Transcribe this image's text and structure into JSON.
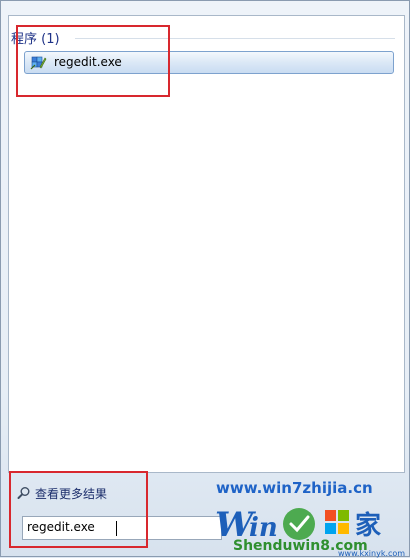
{
  "results": {
    "group_header": "程序 (1)",
    "items": [
      {
        "label": "regedit.exe",
        "icon": "regedit-icon"
      }
    ]
  },
  "footer": {
    "see_more_label": "查看更多结果",
    "search_value": "regedit.exe"
  },
  "watermark": {
    "url": "www.win7zhijia.cn",
    "brand": "Shenduwin8.com",
    "site2": "www.kxinyk.com"
  },
  "colors": {
    "highlight_border": "#d8282e",
    "selected_item_border": "#7da2ce",
    "group_text": "#1e3287"
  }
}
